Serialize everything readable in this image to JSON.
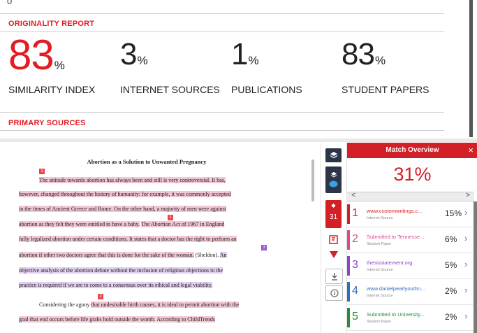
{
  "report": {
    "top_fragment": "0",
    "title": "ORIGINALITY REPORT",
    "stats": [
      {
        "value": "83",
        "unit": "%",
        "label": "SIMILARITY INDEX"
      },
      {
        "value": "3",
        "unit": "%",
        "label": "INTERNET SOURCES"
      },
      {
        "value": "1",
        "unit": "%",
        "label": "PUBLICATIONS"
      },
      {
        "value": "83",
        "unit": "%",
        "label": "STUDENT PAPERS"
      }
    ],
    "primary_sources_label": "PRIMARY SOURCES"
  },
  "document": {
    "title": "Abortion as a Solution to Unwanted Pregnancy",
    "markers": [
      "1",
      "1",
      "3",
      "2"
    ],
    "p1": [
      [
        "The attitude towards abortion has always been and still is very controversial. It has,"
      ],
      [
        "however, changed throughout the history of humanity: for example, it was commonly accepted"
      ],
      [
        "in the times of Ancient Greece and Rome. On the other hand, a majority of men were against"
      ],
      [
        "abortion as they felt they were entitled to have a baby.",
        "The Abortion Act of 1967 in England"
      ],
      [
        "fully legalized abortion under certain conditions. It states that a doctor has the right to perform an"
      ],
      [
        "abortion if other two doctors agree that this is done for the sake of the woman.",
        "(Sheldon).",
        "An"
      ],
      [
        "objective analysis of the abortion debate without the inclusion of religious objections to the"
      ],
      [
        "practice is required if we are to come to a consensus over its ethical and legal viability."
      ]
    ],
    "p2": [
      [
        "Considering the",
        "agony",
        "that undesirable birth causes, it is ideal to permit abortion with the"
      ],
      [
        "goal that end occurs before life grabs hold outside the womb.",
        "According to ChildTrends"
      ]
    ]
  },
  "toolbar": {
    "match_count": "31"
  },
  "panel": {
    "title": "Match Overview",
    "close": "×",
    "overall": "31%",
    "nav_prev": "<",
    "nav_next": ">",
    "sources": [
      {
        "index": "1",
        "name": "www.customwritings.c...",
        "type": "Internet Source",
        "percent": "15%",
        "color": "#d31f26"
      },
      {
        "index": "2",
        "name": "Submitted to Tennesse...",
        "type": "Student Paper",
        "percent": "6%",
        "color": "#d84a8e"
      },
      {
        "index": "3",
        "name": "thesisstatement.org",
        "type": "Internet Source",
        "percent": "5%",
        "color": "#8e44c9"
      },
      {
        "index": "4",
        "name": "www.danielpearlyouthn...",
        "type": "Internet Source",
        "percent": "2%",
        "color": "#2f6db5"
      },
      {
        "index": "5",
        "name": "Submitted to University...",
        "type": "Student Paper",
        "percent": "2%",
        "color": "#2a8b3a"
      }
    ]
  }
}
